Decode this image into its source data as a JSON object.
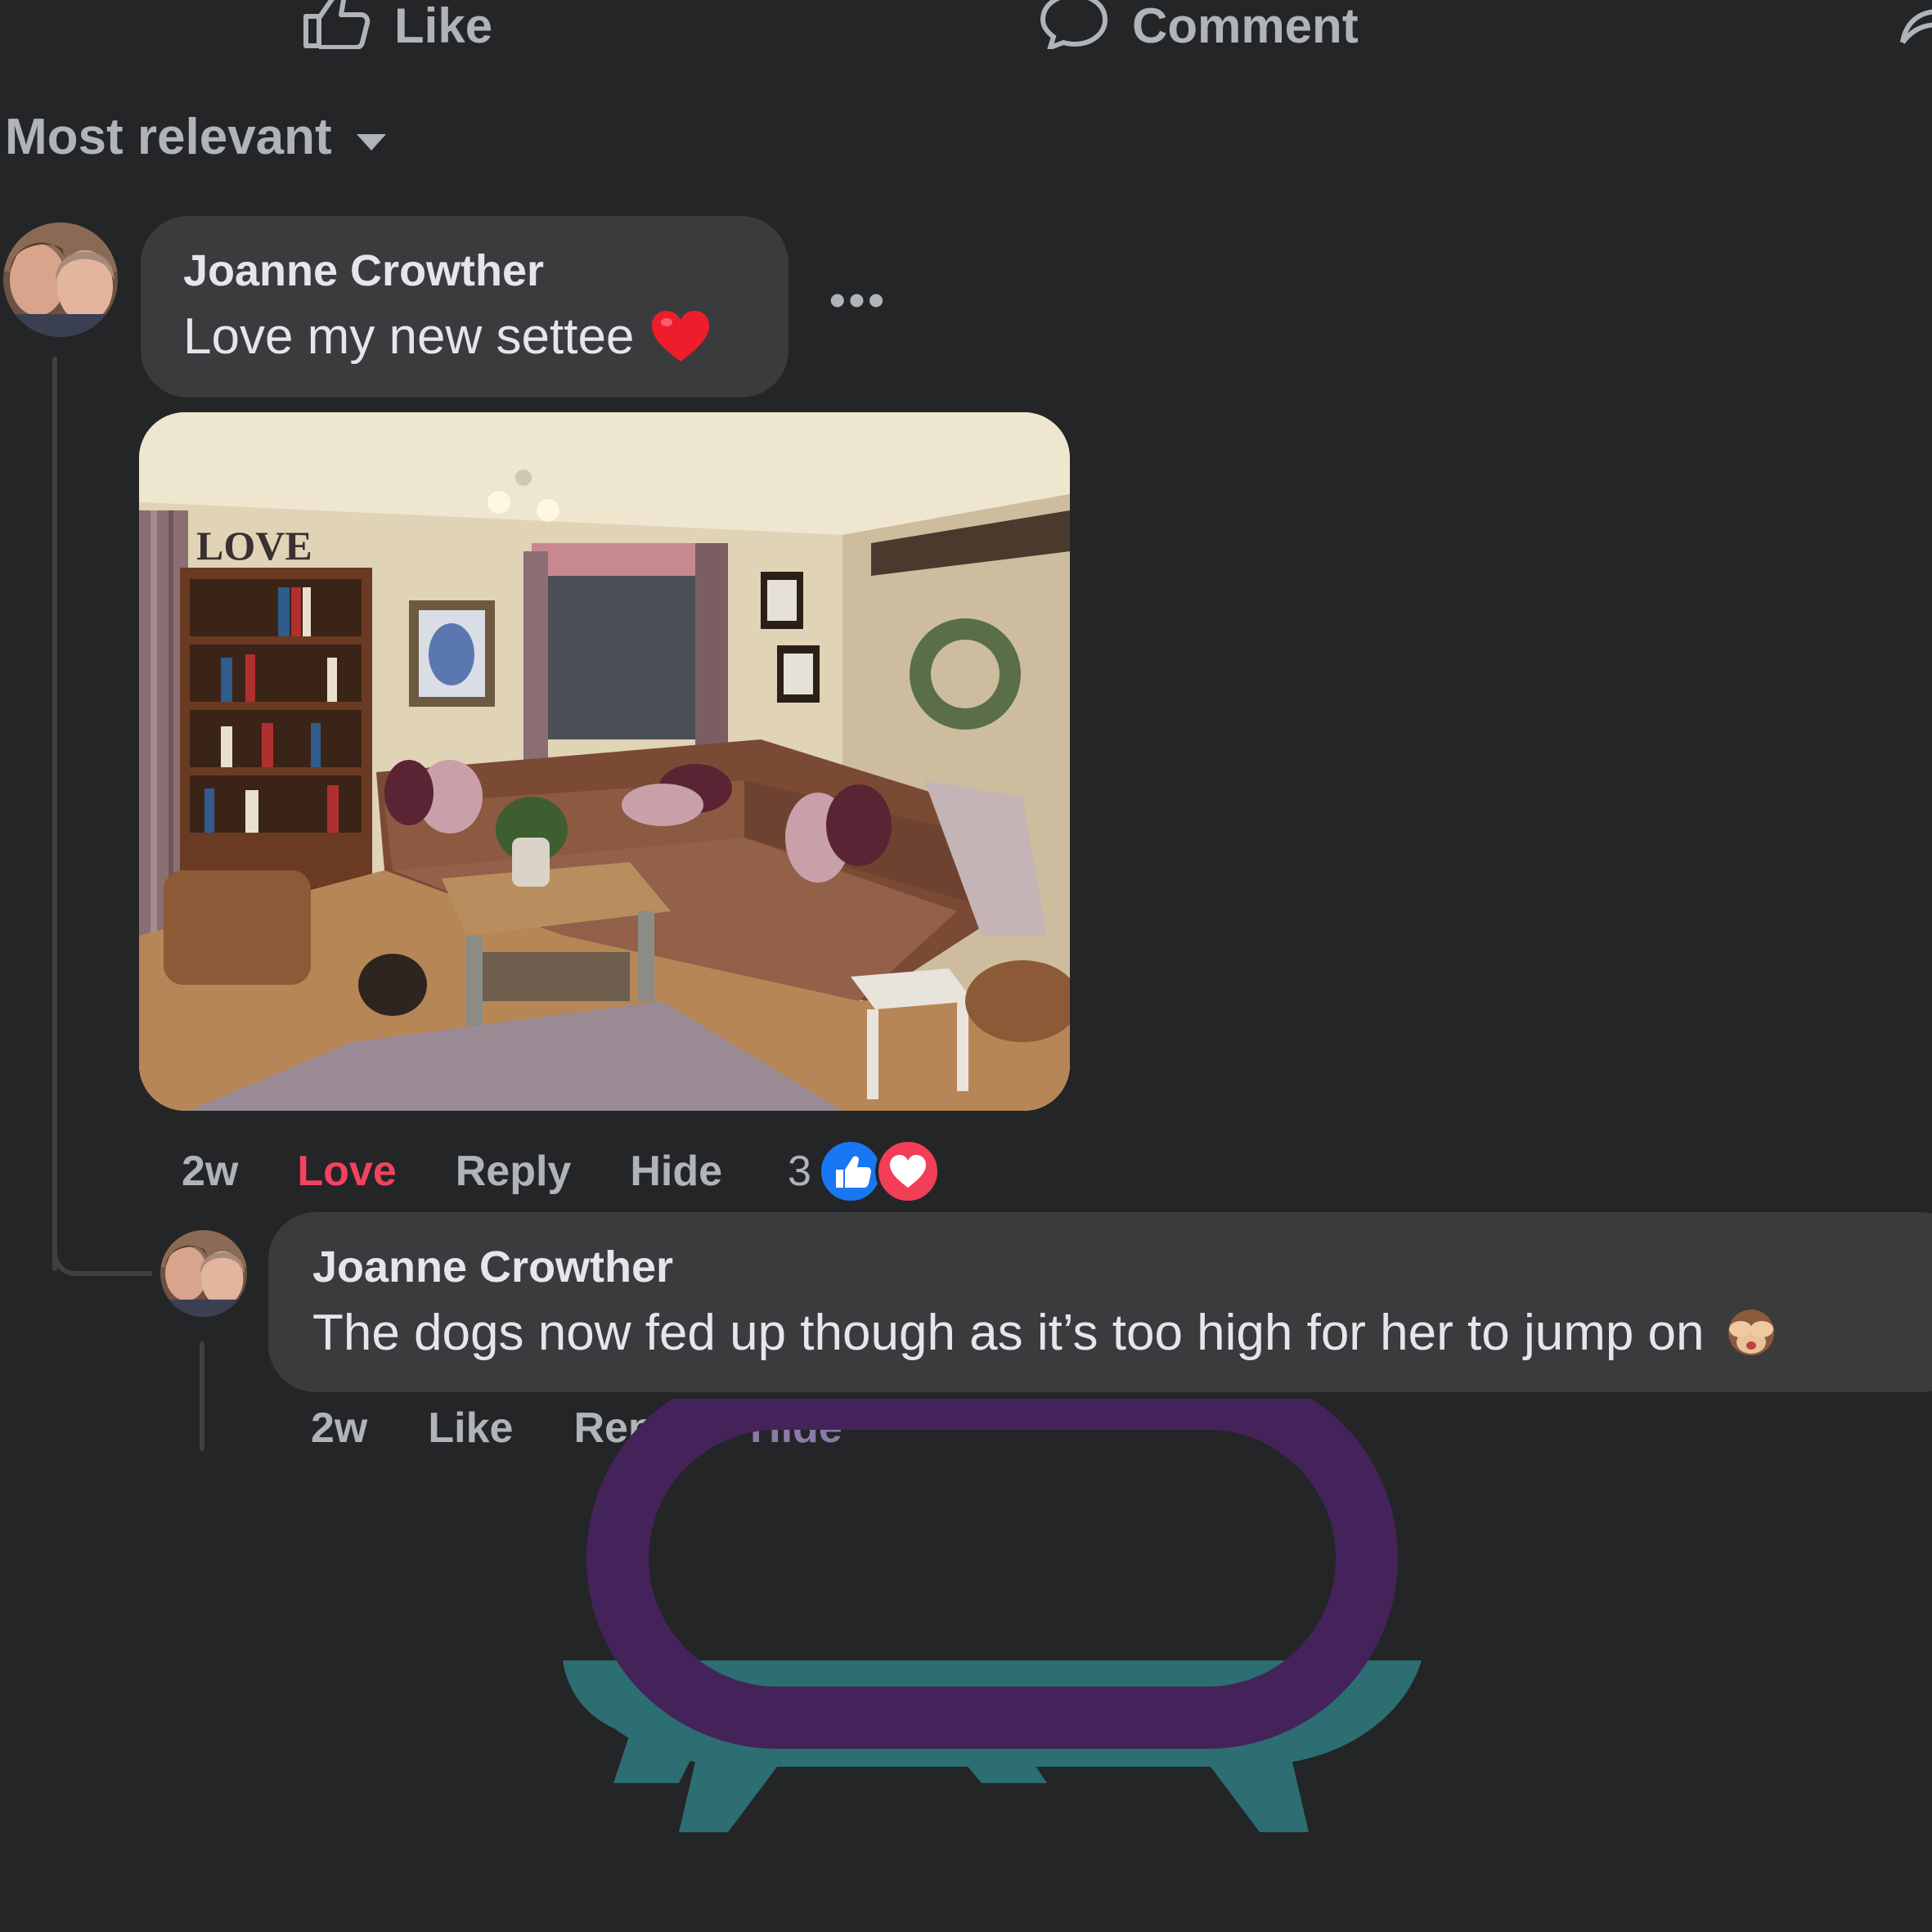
{
  "actions": {
    "like_label": "Like",
    "comment_label": "Comment",
    "like_icon": "thumbs-up-outline-icon",
    "comment_icon": "speech-bubble-outline-icon",
    "share_icon": "share-arrow-icon"
  },
  "sort": {
    "label": "Most relevant",
    "icon": "caret-down-icon"
  },
  "comments": [
    {
      "author": "Joanne Crowther",
      "text": "Love my new settee",
      "emoji": "red-heart-icon",
      "photo": "living-room-photo",
      "meta": {
        "time": "2w",
        "reaction_label": "Love",
        "reply_label": "Reply",
        "hide_label": "Hide",
        "reaction_count": "3",
        "reaction_icons": [
          "like-reaction-icon",
          "love-reaction-icon"
        ]
      }
    },
    {
      "author": "Joanne Crowther",
      "text": "The dogs now fed up though as it’s too high for her to jump on",
      "emoji": "see-no-evil-monkey-icon",
      "meta": {
        "time": "2w",
        "like_label": "Like",
        "reply_label": "Reply",
        "hide_label": "Hide"
      }
    }
  ],
  "colors": {
    "background": "#242526",
    "bubble": "#3a3b3c",
    "love_accent": "#f3425f",
    "like_blue": "#1877f2",
    "logo_purple": "#44235a",
    "logo_teal": "#2c6e71"
  }
}
